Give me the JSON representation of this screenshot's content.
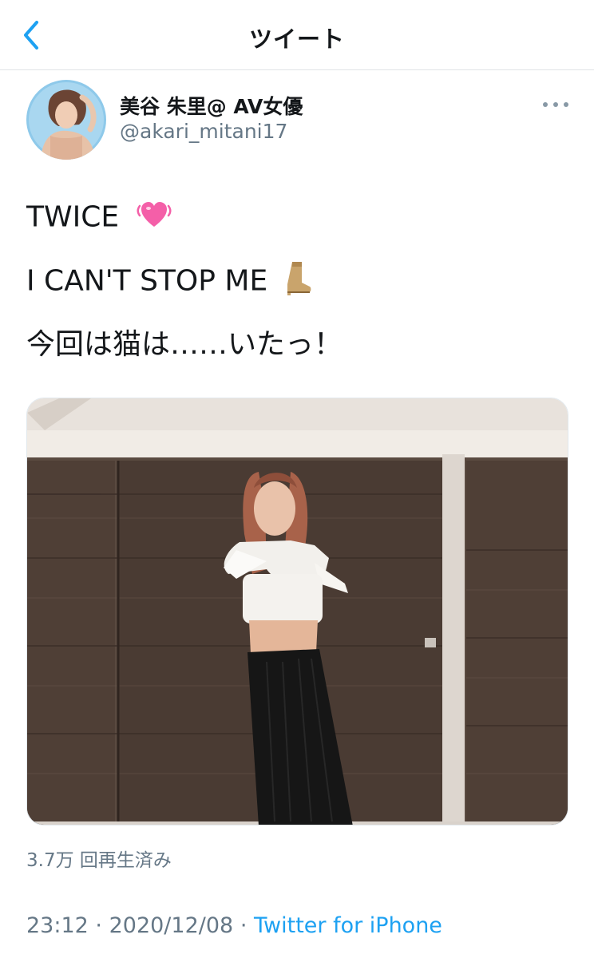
{
  "nav": {
    "title": "ツイート"
  },
  "author": {
    "name": "美谷 朱里@ AV女優",
    "handle": "@akari_mitani17"
  },
  "tweet": {
    "lines": [
      {
        "text": "TWICE",
        "emoji": "growing-heart"
      },
      {
        "text": "I CAN'T STOP ME",
        "emoji": "boot"
      },
      {
        "text": "今回は猫は……いたっ！"
      }
    ]
  },
  "media": {
    "type": "video",
    "views": "3.7万 回再生済み"
  },
  "meta": {
    "time": "23:12",
    "separator": "·",
    "date": "2020/12/08",
    "source": "Twitter for iPhone"
  },
  "colors": {
    "accent": "#1da1f2",
    "secondary_text": "#657786",
    "divider": "#dfe3e6"
  }
}
